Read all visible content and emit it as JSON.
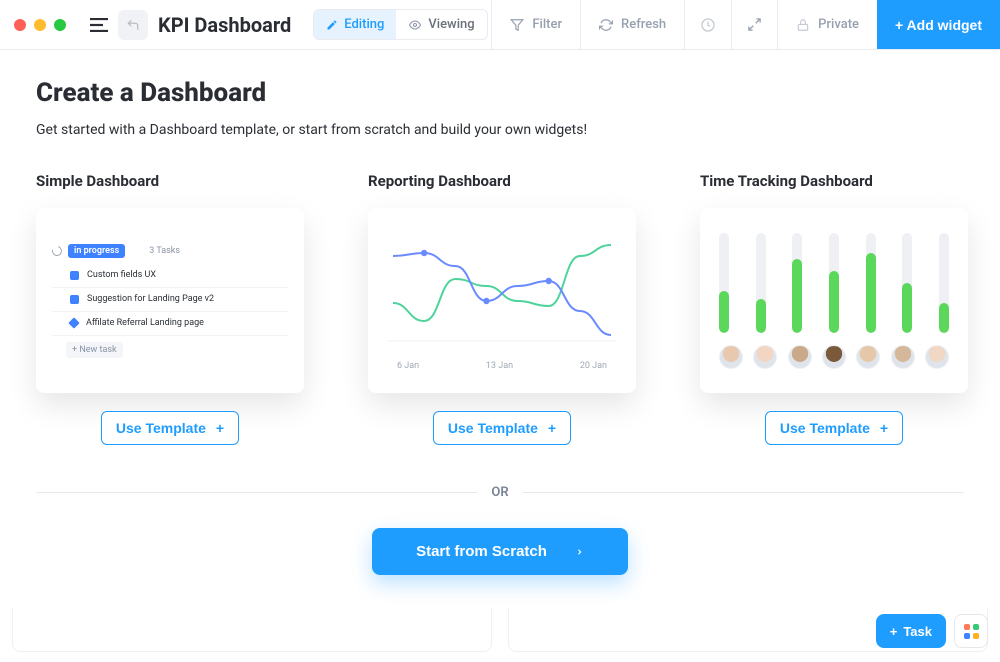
{
  "window": {
    "title": "KPI Dashboard"
  },
  "modes": {
    "editing": "Editing",
    "viewing": "Viewing"
  },
  "toolbar": {
    "filter": "Filter",
    "refresh": "Refresh",
    "private": "Private",
    "add_widget": "+ Add widget"
  },
  "main": {
    "heading": "Create a Dashboard",
    "subtitle": "Get started with a Dashboard template, or start from scratch and build your own widgets!",
    "use_template": "Use Template",
    "or": "OR",
    "scratch": "Start from Scratch"
  },
  "templates": {
    "simple": {
      "title": "Simple Dashboard",
      "badge": "in progress",
      "task_count": "3 Tasks",
      "rows": [
        {
          "color": "#3e82ff",
          "shape": "square",
          "label": "Custom fields UX"
        },
        {
          "color": "#3e82ff",
          "shape": "square",
          "label": "Suggestion for Landing Page v2"
        },
        {
          "color": "#3e82ff",
          "shape": "diamond",
          "label": "Affilate Referral Landing page"
        }
      ],
      "new_task": "+ New task"
    },
    "reporting": {
      "title": "Reporting Dashboard",
      "x_ticks": [
        "6 Jan",
        "13 Jan",
        "20 Jan"
      ]
    },
    "timetracking": {
      "title": "Time Tracking Dashboard",
      "values_pct": [
        42,
        34,
        74,
        62,
        80,
        50,
        30
      ],
      "avatar_tones": [
        "#e8c9b0",
        "#f2d5c2",
        "#c9a988",
        "#7a5a3a",
        "#e6c8a8",
        "#d5b79a",
        "#f0d8c4"
      ]
    }
  },
  "fab": {
    "task": "Task"
  },
  "chart_data": {
    "type": "line",
    "title": "",
    "xlabel": "",
    "ylabel": "",
    "x_ticks": [
      "6 Jan",
      "13 Jan",
      "20 Jan"
    ],
    "ylim": [
      0,
      100
    ],
    "series": [
      {
        "name": "green",
        "color": "#4fd39c",
        "values": [
          38,
          20,
          62,
          55,
          40,
          35,
          85,
          96
        ]
      },
      {
        "name": "blue",
        "color": "#6a8bff",
        "values": [
          85,
          88,
          75,
          40,
          55,
          60,
          30,
          6
        ]
      }
    ]
  }
}
